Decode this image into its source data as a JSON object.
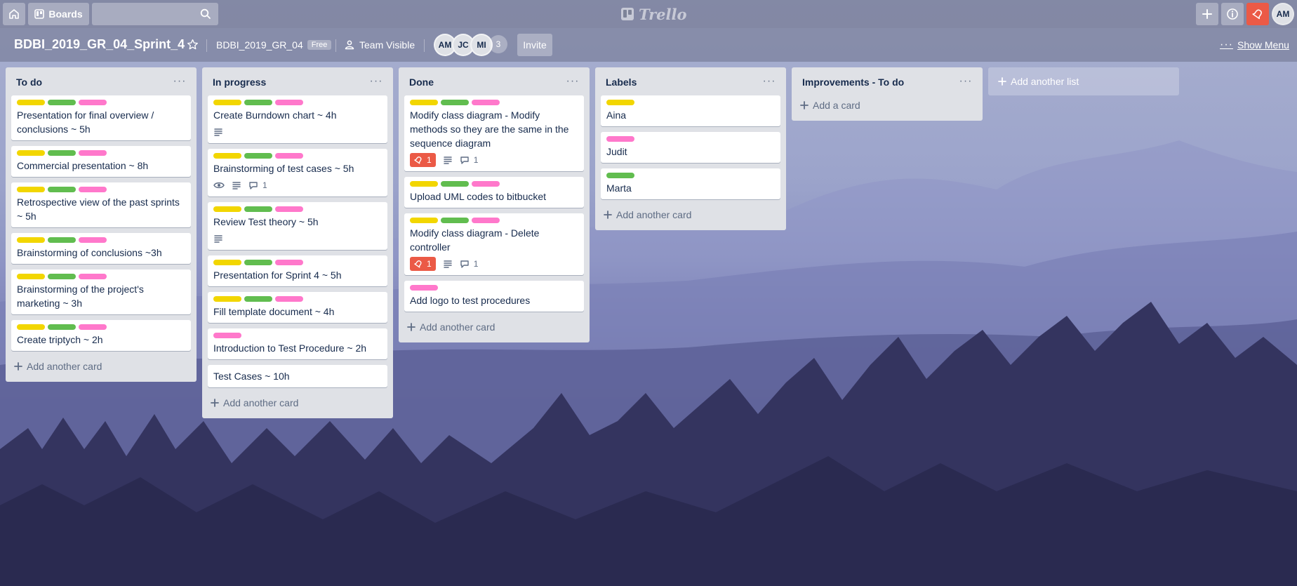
{
  "topbar": {
    "boards_label": "Boards",
    "search_value": "",
    "logo_text": "Trello",
    "user_initials": "AM"
  },
  "board": {
    "title": "BDBI_2019_GR_04_Sprint_4",
    "team_name": "BDBI_2019_GR_04",
    "team_plan": "Free",
    "visibility": "Team Visible",
    "members": [
      "AM",
      "JC",
      "MI"
    ],
    "members_count": "3",
    "invite_label": "Invite",
    "show_menu_label": "Show Menu"
  },
  "colors": {
    "yellow": "#f2d600",
    "green": "#61bd4f",
    "pink": "#ff78cb",
    "red": "#eb5a46"
  },
  "lists": [
    {
      "title": "To do",
      "cards": [
        {
          "title": "Presentation for final overview / conclusions ~ 5h",
          "labels": [
            "yellow",
            "green",
            "pink"
          ]
        },
        {
          "title": "Commercial presentation ~ 8h",
          "labels": [
            "yellow",
            "green",
            "pink"
          ]
        },
        {
          "title": "Retrospective view of the past sprints ~ 5h",
          "labels": [
            "yellow",
            "green",
            "pink"
          ]
        },
        {
          "title": "Brainstorming of conclusions ~3h",
          "labels": [
            "yellow",
            "green",
            "pink"
          ]
        },
        {
          "title": "Brainstorming of the project's marketing ~ 3h",
          "labels": [
            "yellow",
            "green",
            "pink"
          ]
        },
        {
          "title": "Create triptych ~ 2h",
          "labels": [
            "yellow",
            "green",
            "pink"
          ]
        }
      ],
      "add_label": "Add another card"
    },
    {
      "title": "In progress",
      "cards": [
        {
          "title": "Create Burndown chart ~ 4h",
          "labels": [
            "yellow",
            "green",
            "pink"
          ],
          "description": true
        },
        {
          "title": "Brainstorming of test cases ~ 5h",
          "labels": [
            "yellow",
            "green",
            "pink"
          ],
          "watch": true,
          "description": true,
          "comments": "1"
        },
        {
          "title": "Review Test theory ~ 5h",
          "labels": [
            "yellow",
            "green",
            "pink"
          ],
          "description": true
        },
        {
          "title": "Presentation for Sprint 4 ~ 5h",
          "labels": [
            "yellow",
            "green",
            "pink"
          ]
        },
        {
          "title": "Fill template document ~ 4h",
          "labels": [
            "yellow",
            "green",
            "pink"
          ]
        },
        {
          "title": "Introduction to Test Procedure ~ 2h",
          "labels": [
            "pink"
          ]
        },
        {
          "title": "Test Cases ~ 10h",
          "labels": []
        }
      ],
      "add_label": "Add another card"
    },
    {
      "title": "Done",
      "cards": [
        {
          "title": "Modify class diagram - Modify methods so they are the same in the sequence diagram",
          "labels": [
            "yellow",
            "green",
            "pink"
          ],
          "votes": "1",
          "description": true,
          "comments": "1"
        },
        {
          "title": "Upload UML codes to bitbucket",
          "labels": [
            "yellow",
            "green",
            "pink"
          ]
        },
        {
          "title": "Modify class diagram - Delete controller",
          "labels": [
            "yellow",
            "green",
            "pink"
          ],
          "votes": "1",
          "description": true,
          "comments": "1"
        },
        {
          "title": "Add logo to test procedures",
          "labels": [
            "pink"
          ]
        }
      ],
      "add_label": "Add another card"
    },
    {
      "title": "Labels",
      "cards": [
        {
          "title": "Aina",
          "labels": [
            "yellow"
          ]
        },
        {
          "title": "Judit",
          "labels": [
            "pink"
          ]
        },
        {
          "title": "Marta",
          "labels": [
            "green"
          ]
        }
      ],
      "add_label": "Add another card"
    },
    {
      "title": "Improvements - To do",
      "cards": [],
      "add_label": "Add a card"
    }
  ],
  "add_list_label": "Add another list"
}
